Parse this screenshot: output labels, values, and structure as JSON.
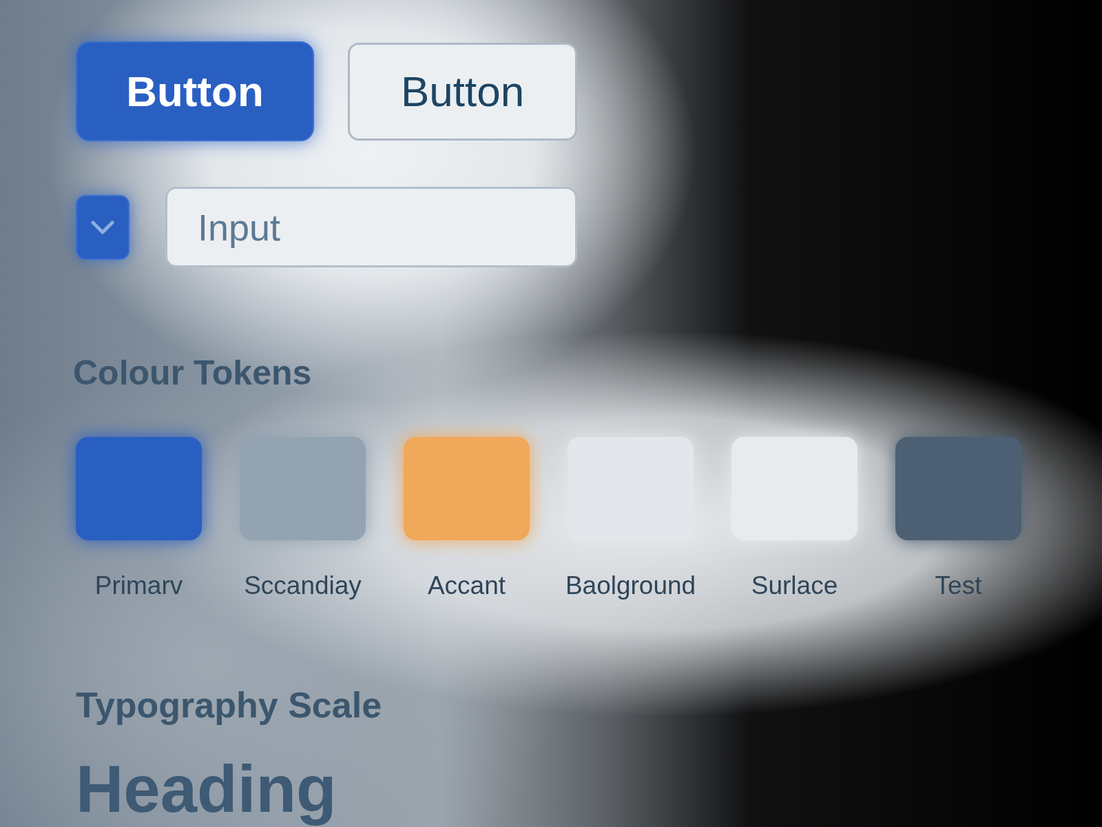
{
  "buttons": [
    {
      "label": "Button",
      "kind": "primary"
    },
    {
      "label": "Button",
      "kind": "secondary"
    }
  ],
  "checkbox": {
    "checked": true
  },
  "input": {
    "placeholder": "Input"
  },
  "colour_tokens": {
    "title": "Colour Tokens",
    "swatches": [
      {
        "label": "Primarv",
        "color": "#2a5fc2"
      },
      {
        "label": "Sccandiay",
        "color": "#93a3b2"
      },
      {
        "label": "Accant",
        "color": "#f0a85a"
      },
      {
        "label": "Baolground",
        "color": "#e3e7eb"
      },
      {
        "label": "Surlace",
        "color": "#e8ebee"
      },
      {
        "label": "Test",
        "color": "#4d5f72"
      }
    ]
  },
  "typography_scale": {
    "title": "Typography Scale",
    "samples": [
      {
        "label": "Heading",
        "kind": "heading"
      }
    ]
  }
}
